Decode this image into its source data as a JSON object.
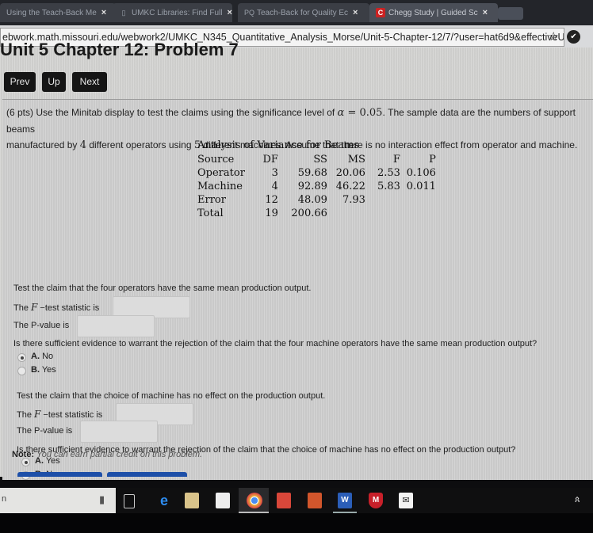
{
  "browser": {
    "tabs": [
      {
        "label": "Using the Teach-Back Me",
        "favicon": "none"
      },
      {
        "label": "UMKC Libraries: Find Full",
        "favicon": "doc-icon"
      },
      {
        "label": "Teach-Back for Quality Ec",
        "favicon_text": "PQ"
      },
      {
        "label": "Chegg Study | Guided Sc",
        "favicon_text": "C"
      }
    ],
    "close_glyph": "×",
    "url": "ebwork.math.missouri.edu/webwork2/UMKC_N345_Quantitative_Analysis_Morse/Unit-5-Chapter-12/7/?user=hat6d9&effectiveUs...",
    "star_glyph": "☆",
    "extension_glyph": "✔"
  },
  "page": {
    "title": "Unit 5 Chapter 12: Problem 7",
    "nav": {
      "prev": "Prev",
      "up": "Up",
      "next": "Next"
    }
  },
  "problem": {
    "points": "(6 pts)",
    "intro_a": " Use the Minitab display to test the claims using the significance level of ",
    "alpha_symbol": "α",
    "equals": " = ",
    "alpha_value": "0.05",
    "intro_b": ". The sample data are the numbers of support beams",
    "intro_c": "manufactured by ",
    "operators": "4",
    "intro_d": " different operators using ",
    "machines": "5",
    "intro_e": " different machines. Assume that there is no interaction effect from operator and machine.",
    "anova": {
      "title": "Analysis of Variance for Beams",
      "headers": [
        "Source",
        "DF",
        "SS",
        "MS",
        "F",
        "P"
      ],
      "rows": [
        [
          "Operator",
          "3",
          "59.68",
          "20.06",
          "2.53",
          "0.106"
        ],
        [
          "Machine",
          "4",
          "92.89",
          "46.22",
          "5.83",
          "0.011"
        ],
        [
          "Error",
          "12",
          "48.09",
          "7.93",
          "",
          ""
        ],
        [
          "Total",
          "19",
          "200.66",
          "",
          "",
          ""
        ]
      ]
    },
    "part1": {
      "claim": "Test the claim that the four operators have the same mean production output.",
      "f_label_pre": "The ",
      "f_symbol": "F",
      "f_label_post": " −test statistic is",
      "f_value": "",
      "p_label": "The P-value is",
      "p_value": "",
      "question": "Is there sufficient evidence to warrant the rejection of the claim that the four machine operators have the same mean production output?",
      "options": [
        {
          "letter": "A.",
          "text": "No",
          "selected": true
        },
        {
          "letter": "B.",
          "text": "Yes",
          "selected": false
        }
      ]
    },
    "part2": {
      "claim": "Test the claim that the choice of machine has no effect on the production output.",
      "f_label_pre": "The ",
      "f_symbol": "F",
      "f_label_post": " −test statistic is",
      "f_value": "",
      "p_label": "The P-value is",
      "p_value": "",
      "question": "Is there sufficient evidence to warrant the rejection of the claim that the choice of machine has no effect on the production output?",
      "options": [
        {
          "letter": "A.",
          "text": "Yes",
          "selected": true
        },
        {
          "letter": "B.",
          "text": "No",
          "selected": false
        }
      ]
    },
    "note_label": "Note:",
    "note_text": " You can earn partial credit on this problem."
  },
  "taskbar": {
    "search_text": "n",
    "mic_glyph": "🎤",
    "icons": [
      "task-view",
      "edge",
      "file-explorer",
      "store",
      "chrome",
      "reader",
      "powerpoint",
      "word",
      "mcafee",
      "mail"
    ],
    "people_glyph": "ጰ"
  }
}
